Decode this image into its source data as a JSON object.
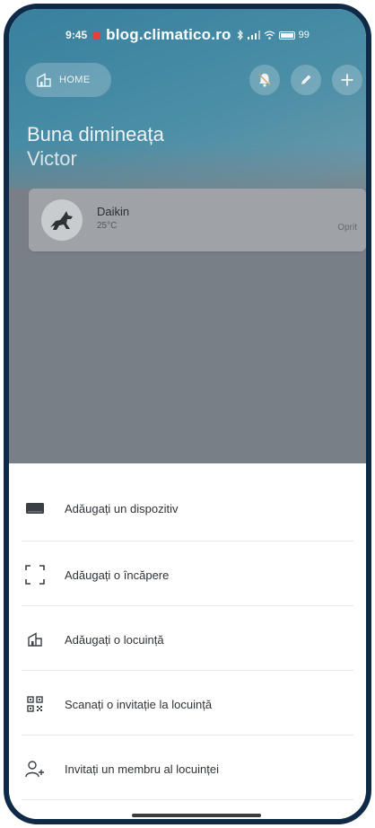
{
  "status_bar": {
    "time": "9:45",
    "watermark": "blog.climatico.ro",
    "battery": "99"
  },
  "top_bar": {
    "home_label": "HOME"
  },
  "greeting": {
    "line1": "Buna dimineața",
    "name": "Victor"
  },
  "device": {
    "name": "Daikin",
    "temperature": "25°C",
    "state": "Oprit"
  },
  "sheet": {
    "items": [
      {
        "label": "Adăugați un dispozitiv",
        "icon": "device-icon"
      },
      {
        "label": "Adăugați o încăpere",
        "icon": "room-frame-icon"
      },
      {
        "label": "Adăugați o locuință",
        "icon": "house-icon"
      },
      {
        "label": "Scanați o invitație la locuință",
        "icon": "qr-code-icon"
      },
      {
        "label": "Invitați un membru al locuinței",
        "icon": "add-person-icon"
      }
    ]
  },
  "colors": {
    "frame": "#0f2a47",
    "accent_gradient_start": "#2f8fb5",
    "accent_gradient_end": "#e7b46a"
  }
}
